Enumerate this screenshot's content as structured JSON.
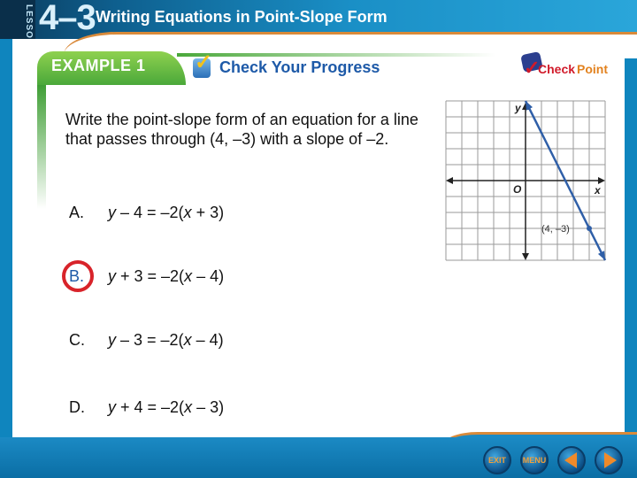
{
  "header": {
    "lesson_word": "LESSON",
    "lesson_number": "4–3",
    "title": "Writing Equations in Point-Slope Form"
  },
  "banner": {
    "example_label": "EXAMPLE 1",
    "check_your_progress": "Check Your Progress",
    "checkpoint_part1": "Check",
    "checkpoint_part2": "Point"
  },
  "question": "Write the point-slope form of an equation for a line that passes through (4, –3) with a slope of –2.",
  "answers": [
    {
      "letter": "A.",
      "y": "y",
      "mid": " – 4 = –2(",
      "x": "x",
      "end": " + 3)",
      "selected": false
    },
    {
      "letter": "B.",
      "y": "y",
      "mid": " + 3 = –2(",
      "x": "x",
      "end": " – 4)",
      "selected": true
    },
    {
      "letter": "C.",
      "y": "y",
      "mid": " – 3 = –2(",
      "x": "x",
      "end": " – 4)",
      "selected": false
    },
    {
      "letter": "D.",
      "y": "y",
      "mid": " + 4 = –2(",
      "x": "x",
      "end": " – 3)",
      "selected": false
    }
  ],
  "graph": {
    "x_label": "x",
    "y_label": "y",
    "origin_label": "O",
    "point_label": "(4, –3)",
    "point": [
      4,
      -3
    ],
    "slope": -2,
    "x_range": [
      -5,
      5
    ],
    "y_range": [
      -5,
      5
    ],
    "line_color": "#2f5fa8"
  },
  "footer": {
    "exit_label": "EXIT",
    "menu_label": "MENU"
  },
  "colors": {
    "accent_blue": "#0f85be",
    "green": "#4aa83a",
    "selection_red": "#d8232a",
    "orange": "#f08a2a"
  }
}
